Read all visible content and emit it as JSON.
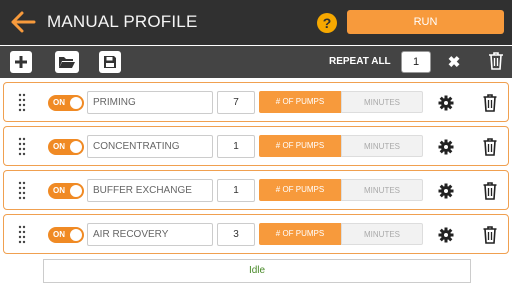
{
  "header": {
    "title": "MANUAL PROFILE",
    "help_label": "?",
    "run_label": "RUN"
  },
  "toolbar": {
    "repeat_label": "REPEAT ALL",
    "repeat_value": "1",
    "clear_glyph": "✖"
  },
  "steps": [
    {
      "enabled": true,
      "toggle_label": "ON",
      "name": "PRIMING",
      "count": "7",
      "mode_pumps": "# OF PUMPS",
      "mode_minutes": "MINUTES",
      "selected_mode": "pumps"
    },
    {
      "enabled": true,
      "toggle_label": "ON",
      "name": "CONCENTRATING",
      "count": "1",
      "mode_pumps": "# OF PUMPS",
      "mode_minutes": "MINUTES",
      "selected_mode": "pumps"
    },
    {
      "enabled": true,
      "toggle_label": "ON",
      "name": "BUFFER EXCHANGE",
      "count": "1",
      "mode_pumps": "# OF PUMPS",
      "mode_minutes": "MINUTES",
      "selected_mode": "pumps"
    },
    {
      "enabled": true,
      "toggle_label": "ON",
      "name": "AIR RECOVERY",
      "count": "3",
      "mode_pumps": "# OF PUMPS",
      "mode_minutes": "MINUTES",
      "selected_mode": "pumps"
    }
  ],
  "status": {
    "text": "Idle"
  },
  "colors": {
    "accent": "#f79a3c",
    "header_bg": "#303030",
    "toolbar_bg": "#444444",
    "status_text": "#4a8a2a"
  },
  "icons": [
    "back-arrow-icon",
    "help-icon",
    "add-icon",
    "folder-icon",
    "save-icon",
    "clear-icon",
    "trash-icon",
    "drag-handle-icon",
    "gear-icon"
  ]
}
